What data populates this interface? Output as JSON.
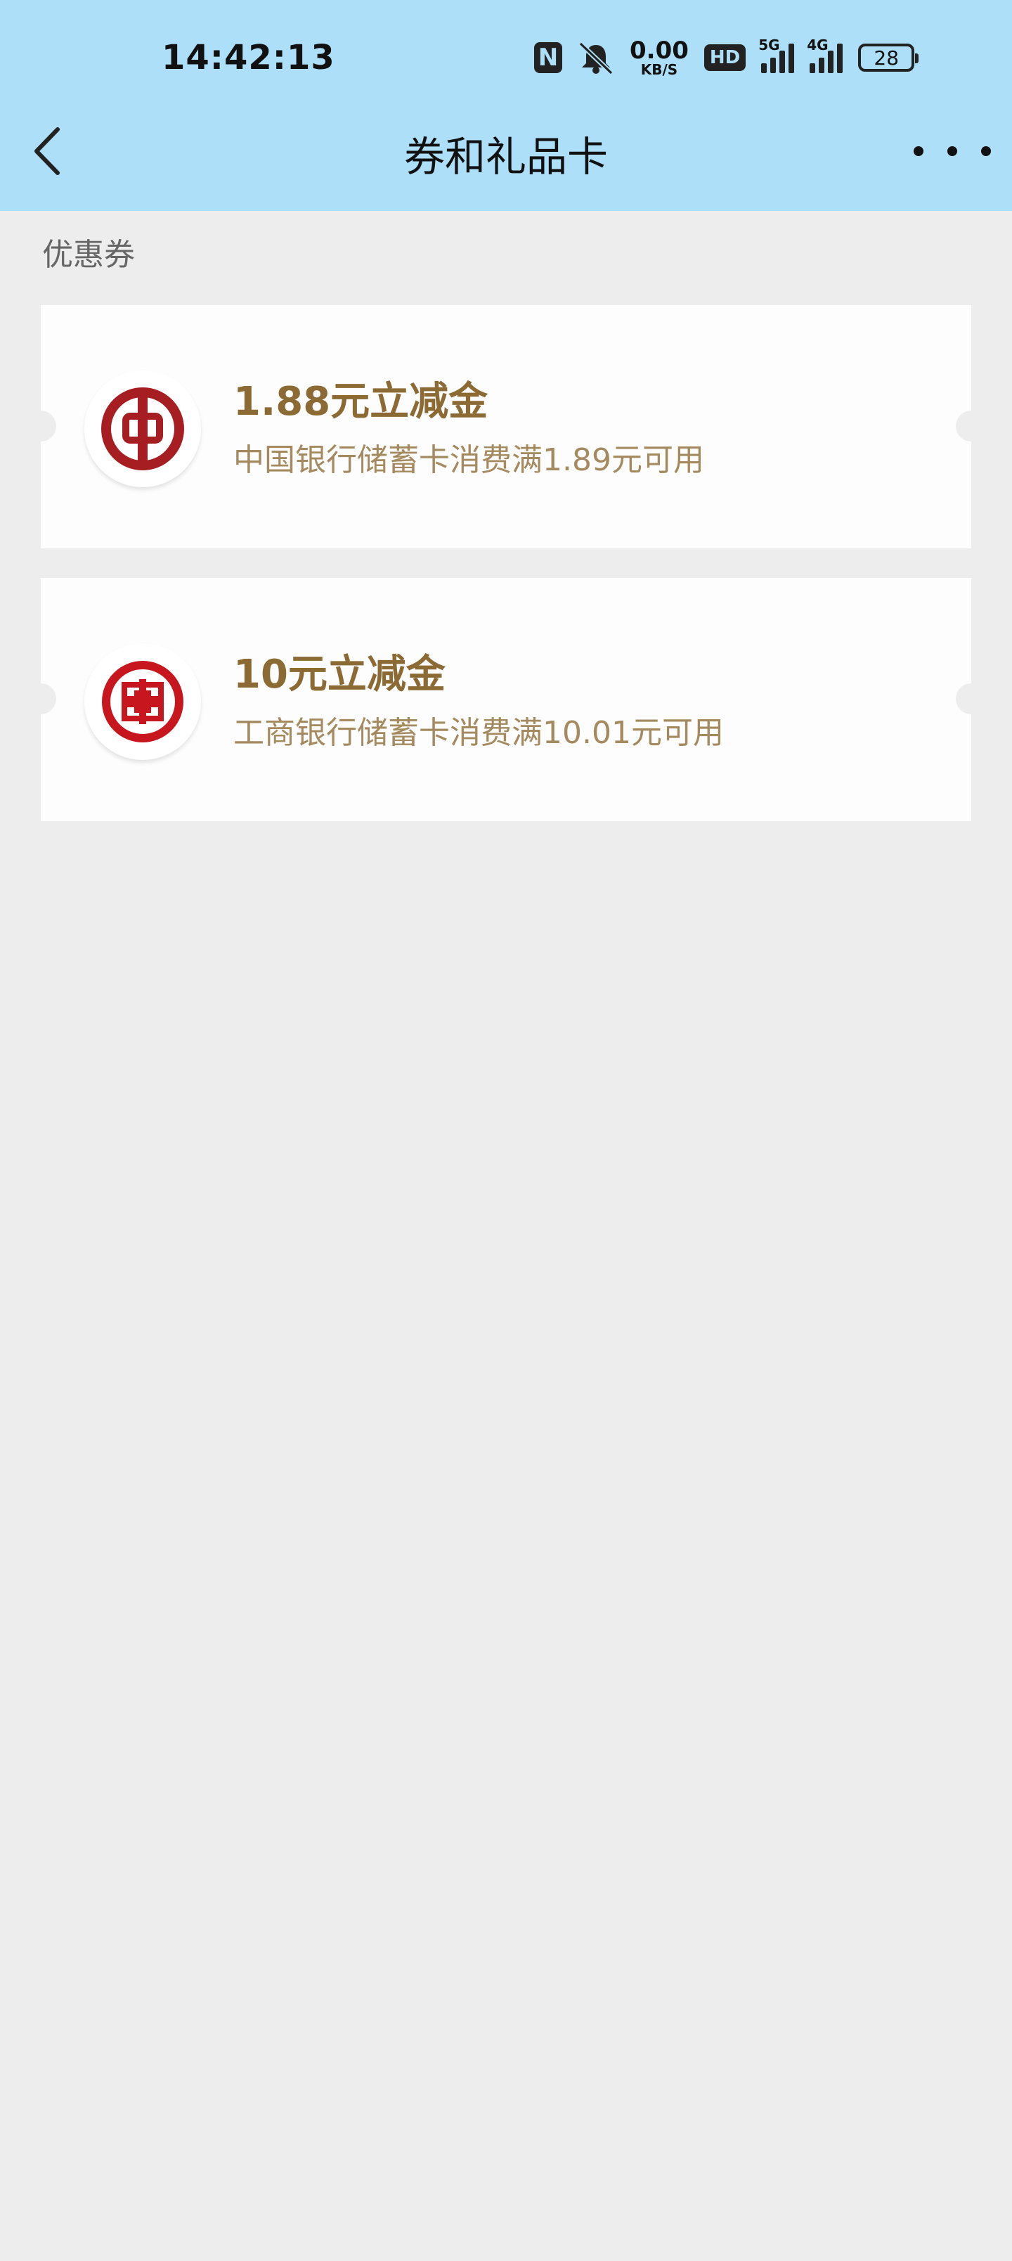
{
  "status_bar": {
    "time": "14:42:13",
    "nfc": "N",
    "mute_icon": "bell-off-icon",
    "net_speed_value": "0.00",
    "net_speed_unit": "KB/S",
    "hd": "HD",
    "signal_1_type": "5G",
    "signal_2_type": "4G",
    "battery_level": "28"
  },
  "nav": {
    "back_icon": "chevron-left-icon",
    "title": "券和礼品卡",
    "more_icon": "more-dots-icon"
  },
  "section": {
    "title": "优惠券"
  },
  "coupons": [
    {
      "bank_logo": "bank-of-china-logo",
      "amount": "1.88元立减金",
      "condition": "中国银行储蓄卡消费满1.89元可用"
    },
    {
      "bank_logo": "icbc-logo",
      "amount": "10元立减金",
      "condition": "工商银行储蓄卡消费满10.01元可用"
    }
  ],
  "colors": {
    "header_bg": "#addff9",
    "page_bg": "#ededed",
    "amount_text": "#8b6a33",
    "condition_text": "#a48a5e",
    "boc_red": "#a71e22",
    "icbc_red": "#c7161e"
  }
}
